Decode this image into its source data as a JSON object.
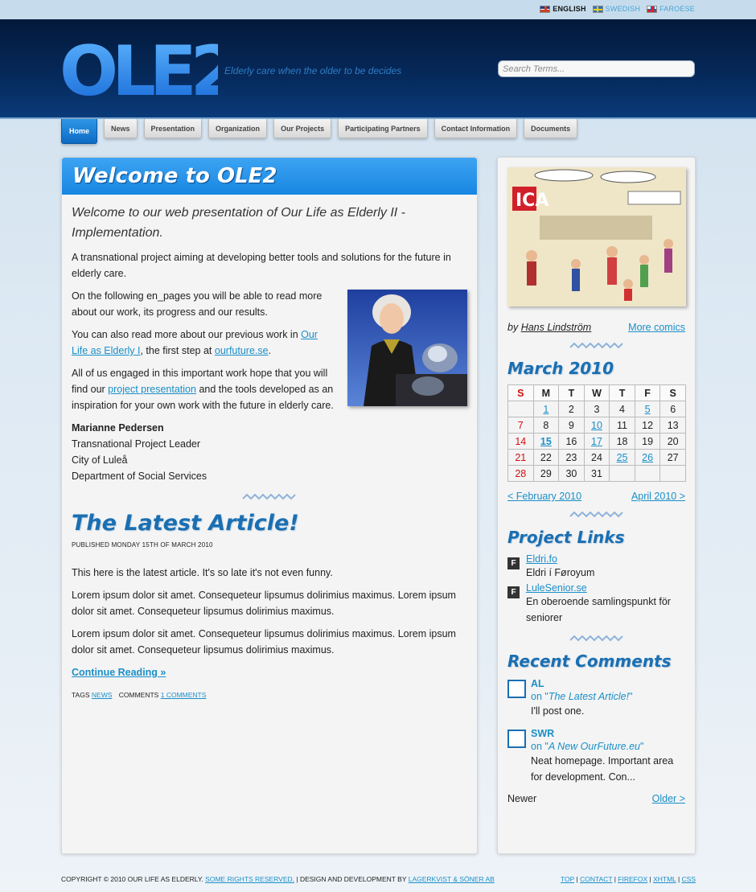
{
  "languages": [
    {
      "label": "ENGLISH",
      "active": true
    },
    {
      "label": "SWEDISH",
      "active": false
    },
    {
      "label": "FAROESE",
      "active": false
    }
  ],
  "header": {
    "logo_text": "OLE2",
    "tagline": "Elderly care when the older to be decides",
    "search_placeholder": "Search Terms..."
  },
  "nav": [
    "Home",
    "News",
    "Presentation",
    "Organization",
    "Our Projects",
    "Participating Partners",
    "Contact Information",
    "Documents"
  ],
  "main": {
    "title": "Welcome to OLE2",
    "intro": "Welcome to our web presentation of Our Life as Elderly II - Implementation.",
    "p1": "A transnational project aiming at developing better tools and solutions for the future in elderly care.",
    "p2": "On the following en_pages you will be able to read more about our work, its progress and our results.",
    "p3_pre": "You can also read more about our previous work in ",
    "p3_link1": "Our Life as Elderly I",
    "p3_mid": ", the first step at ",
    "p3_link2": "ourfuture.se",
    "p3_post": ".",
    "p4_pre": "All of us engaged in this important work hope that you will find our ",
    "p4_link": "project presentation",
    "p4_post": " and the tools developed as an inspiration for your own work with the future in elderly care.",
    "sig_name": "Marianne Pedersen",
    "sig_line1": "Transnational Project Leader",
    "sig_line2": "City of Luleå",
    "sig_line3": "Department of Social Services"
  },
  "article": {
    "title": "The Latest Article!",
    "published": "PUBLISHED MONDAY 15TH OF MARCH 2010",
    "p1": "This here is the latest article. It's so late it's not even funny.",
    "p2": "Lorem ipsum dolor sit amet. Consequeteur lipsumus dolirimius maximus. Lorem ipsum dolor sit amet. Consequeteur lipsumus dolirimius maximus.",
    "p3": "Lorem ipsum dolor sit amet. Consequeteur lipsumus dolirimius maximus. Lorem ipsum dolor sit amet. Consequeteur lipsumus dolirimius maximus.",
    "continue": "Continue Reading »",
    "tags_label": "TAGS",
    "tag": "NEWS",
    "comments_label": "COMMENTS",
    "comments_link": "1 COMMENTS"
  },
  "sidebar": {
    "comic_by": "by ",
    "comic_author": "Hans Lindström",
    "more_comics": "More comics",
    "calendar_title": "March 2010",
    "calendar_days": [
      "S",
      "M",
      "T",
      "W",
      "T",
      "F",
      "S"
    ],
    "calendar_weeks": [
      [
        "",
        "1",
        "2",
        "3",
        "4",
        "5",
        "6"
      ],
      [
        "7",
        "8",
        "9",
        "10",
        "11",
        "12",
        "13"
      ],
      [
        "14",
        "15",
        "16",
        "17",
        "18",
        "19",
        "20"
      ],
      [
        "21",
        "22",
        "23",
        "24",
        "25",
        "26",
        "27"
      ],
      [
        "28",
        "29",
        "30",
        "31",
        "",
        "",
        ""
      ]
    ],
    "calendar_links": [
      "1",
      "5",
      "10",
      "15",
      "17",
      "25",
      "26"
    ],
    "calendar_today": "15",
    "cal_prev": "< February 2010",
    "cal_next": "April 2010 >",
    "links_title": "Project Links",
    "links": [
      {
        "label": "Eldri.fo",
        "desc": "Eldri í Føroyum"
      },
      {
        "label": "LuleSenior.se",
        "desc": "En oberoende samlingspunkt för seniorer"
      }
    ],
    "comments_title": "Recent Comments",
    "comments": [
      {
        "author": "AL",
        "on": "The Latest Article!",
        "text": "I'll post one."
      },
      {
        "author": "SWR",
        "on": "A New OurFuture.eu",
        "text": "Neat homepage. Important area for development. Con..."
      }
    ],
    "newer": "Newer",
    "older": "Older >"
  },
  "footer": {
    "copyright": "COPYRIGHT © 2010 OUR LIFE AS ELDERLY. ",
    "rights": "SOME RIGHTS RESERVED.",
    "design": " | DESIGN AND DEVELOPMENT BY ",
    "designer": "LAGERKVIST & SÖNER AB",
    "links": [
      "TOP",
      "CONTACT",
      "FIREFOX",
      "XHTML",
      "CSS"
    ]
  }
}
